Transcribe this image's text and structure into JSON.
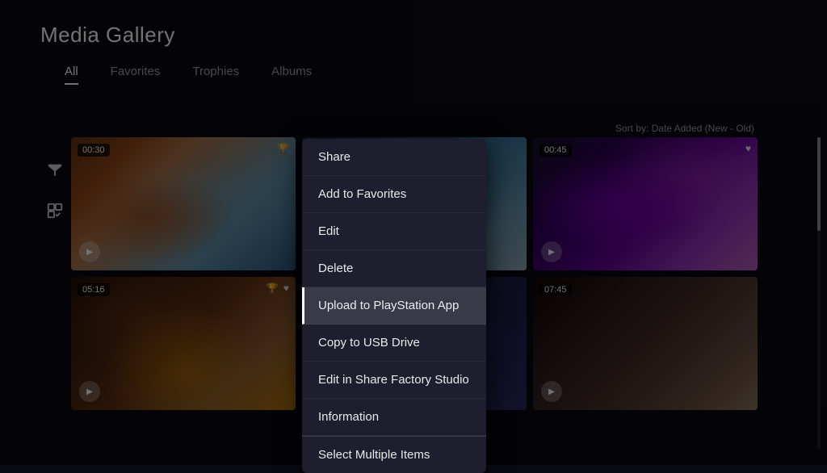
{
  "header": {
    "title": "Media Gallery"
  },
  "nav": {
    "tabs": [
      {
        "label": "All",
        "active": true
      },
      {
        "label": "Favorites",
        "active": false
      },
      {
        "label": "Trophies",
        "active": false
      },
      {
        "label": "Albums",
        "active": false
      }
    ]
  },
  "sort": {
    "label": "Sort by: Date Added (New - Old)"
  },
  "sidebar": {
    "icons": [
      {
        "name": "filter-icon",
        "symbol": "filter"
      },
      {
        "name": "select-icon",
        "symbol": "select"
      }
    ]
  },
  "grid": {
    "items": [
      {
        "id": 1,
        "duration": "00:30",
        "hasTrophy": true,
        "hasHeart": false,
        "hasPlay": true
      },
      {
        "id": 2,
        "duration": null,
        "hasTrophy": false,
        "hasHeart": false,
        "hasPlay": false
      },
      {
        "id": 3,
        "duration": "00:45",
        "hasTrophy": false,
        "hasHeart": true,
        "hasPlay": true
      },
      {
        "id": 4,
        "duration": "05:16",
        "hasTrophy": true,
        "hasHeart": true,
        "hasPlay": true
      },
      {
        "id": 5,
        "duration": null,
        "hasTrophy": false,
        "hasHeart": false,
        "hasPlay": false
      },
      {
        "id": 6,
        "duration": "07:45",
        "hasTrophy": false,
        "hasHeart": false,
        "hasPlay": true
      }
    ]
  },
  "context_menu": {
    "items": [
      {
        "id": "share",
        "label": "Share",
        "highlighted": false,
        "separator_above": false
      },
      {
        "id": "add-to-favorites",
        "label": "Add to Favorites",
        "highlighted": false,
        "separator_above": false
      },
      {
        "id": "edit",
        "label": "Edit",
        "highlighted": false,
        "separator_above": false
      },
      {
        "id": "delete",
        "label": "Delete",
        "highlighted": false,
        "separator_above": false
      },
      {
        "id": "upload-ps-app",
        "label": "Upload to PlayStation App",
        "highlighted": true,
        "separator_above": false
      },
      {
        "id": "copy-usb",
        "label": "Copy to USB Drive",
        "highlighted": false,
        "separator_above": false
      },
      {
        "id": "share-factory",
        "label": "Edit in Share Factory Studio",
        "highlighted": false,
        "separator_above": false
      },
      {
        "id": "information",
        "label": "Information",
        "highlighted": false,
        "separator_above": false
      },
      {
        "id": "select-multiple",
        "label": "Select Multiple Items",
        "highlighted": false,
        "separator_above": true
      }
    ]
  }
}
